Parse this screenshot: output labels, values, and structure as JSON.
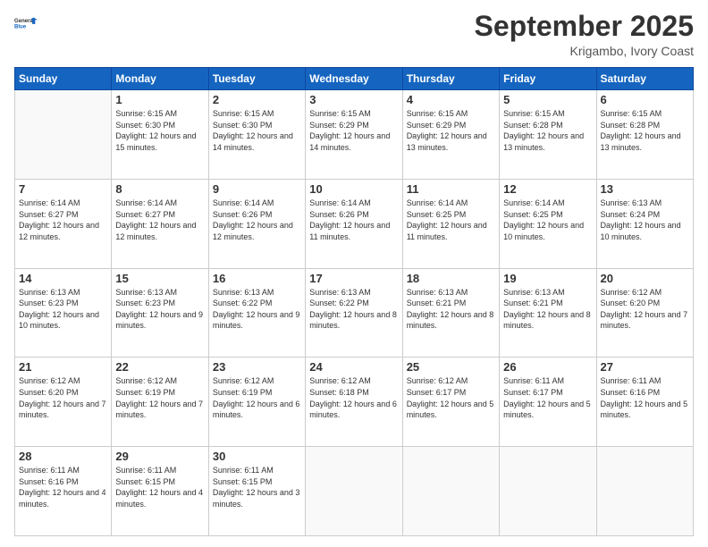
{
  "logo": {
    "line1": "General",
    "line2": "Blue"
  },
  "header": {
    "month": "September 2025",
    "location": "Krigambo, Ivory Coast"
  },
  "weekdays": [
    "Sunday",
    "Monday",
    "Tuesday",
    "Wednesday",
    "Thursday",
    "Friday",
    "Saturday"
  ],
  "weeks": [
    [
      {
        "day": "",
        "sunrise": "",
        "sunset": "",
        "daylight": ""
      },
      {
        "day": "1",
        "sunrise": "Sunrise: 6:15 AM",
        "sunset": "Sunset: 6:30 PM",
        "daylight": "Daylight: 12 hours and 15 minutes."
      },
      {
        "day": "2",
        "sunrise": "Sunrise: 6:15 AM",
        "sunset": "Sunset: 6:30 PM",
        "daylight": "Daylight: 12 hours and 14 minutes."
      },
      {
        "day": "3",
        "sunrise": "Sunrise: 6:15 AM",
        "sunset": "Sunset: 6:29 PM",
        "daylight": "Daylight: 12 hours and 14 minutes."
      },
      {
        "day": "4",
        "sunrise": "Sunrise: 6:15 AM",
        "sunset": "Sunset: 6:29 PM",
        "daylight": "Daylight: 12 hours and 13 minutes."
      },
      {
        "day": "5",
        "sunrise": "Sunrise: 6:15 AM",
        "sunset": "Sunset: 6:28 PM",
        "daylight": "Daylight: 12 hours and 13 minutes."
      },
      {
        "day": "6",
        "sunrise": "Sunrise: 6:15 AM",
        "sunset": "Sunset: 6:28 PM",
        "daylight": "Daylight: 12 hours and 13 minutes."
      }
    ],
    [
      {
        "day": "7",
        "sunrise": "Sunrise: 6:14 AM",
        "sunset": "Sunset: 6:27 PM",
        "daylight": "Daylight: 12 hours and 12 minutes."
      },
      {
        "day": "8",
        "sunrise": "Sunrise: 6:14 AM",
        "sunset": "Sunset: 6:27 PM",
        "daylight": "Daylight: 12 hours and 12 minutes."
      },
      {
        "day": "9",
        "sunrise": "Sunrise: 6:14 AM",
        "sunset": "Sunset: 6:26 PM",
        "daylight": "Daylight: 12 hours and 12 minutes."
      },
      {
        "day": "10",
        "sunrise": "Sunrise: 6:14 AM",
        "sunset": "Sunset: 6:26 PM",
        "daylight": "Daylight: 12 hours and 11 minutes."
      },
      {
        "day": "11",
        "sunrise": "Sunrise: 6:14 AM",
        "sunset": "Sunset: 6:25 PM",
        "daylight": "Daylight: 12 hours and 11 minutes."
      },
      {
        "day": "12",
        "sunrise": "Sunrise: 6:14 AM",
        "sunset": "Sunset: 6:25 PM",
        "daylight": "Daylight: 12 hours and 10 minutes."
      },
      {
        "day": "13",
        "sunrise": "Sunrise: 6:13 AM",
        "sunset": "Sunset: 6:24 PM",
        "daylight": "Daylight: 12 hours and 10 minutes."
      }
    ],
    [
      {
        "day": "14",
        "sunrise": "Sunrise: 6:13 AM",
        "sunset": "Sunset: 6:23 PM",
        "daylight": "Daylight: 12 hours and 10 minutes."
      },
      {
        "day": "15",
        "sunrise": "Sunrise: 6:13 AM",
        "sunset": "Sunset: 6:23 PM",
        "daylight": "Daylight: 12 hours and 9 minutes."
      },
      {
        "day": "16",
        "sunrise": "Sunrise: 6:13 AM",
        "sunset": "Sunset: 6:22 PM",
        "daylight": "Daylight: 12 hours and 9 minutes."
      },
      {
        "day": "17",
        "sunrise": "Sunrise: 6:13 AM",
        "sunset": "Sunset: 6:22 PM",
        "daylight": "Daylight: 12 hours and 8 minutes."
      },
      {
        "day": "18",
        "sunrise": "Sunrise: 6:13 AM",
        "sunset": "Sunset: 6:21 PM",
        "daylight": "Daylight: 12 hours and 8 minutes."
      },
      {
        "day": "19",
        "sunrise": "Sunrise: 6:13 AM",
        "sunset": "Sunset: 6:21 PM",
        "daylight": "Daylight: 12 hours and 8 minutes."
      },
      {
        "day": "20",
        "sunrise": "Sunrise: 6:12 AM",
        "sunset": "Sunset: 6:20 PM",
        "daylight": "Daylight: 12 hours and 7 minutes."
      }
    ],
    [
      {
        "day": "21",
        "sunrise": "Sunrise: 6:12 AM",
        "sunset": "Sunset: 6:20 PM",
        "daylight": "Daylight: 12 hours and 7 minutes."
      },
      {
        "day": "22",
        "sunrise": "Sunrise: 6:12 AM",
        "sunset": "Sunset: 6:19 PM",
        "daylight": "Daylight: 12 hours and 7 minutes."
      },
      {
        "day": "23",
        "sunrise": "Sunrise: 6:12 AM",
        "sunset": "Sunset: 6:19 PM",
        "daylight": "Daylight: 12 hours and 6 minutes."
      },
      {
        "day": "24",
        "sunrise": "Sunrise: 6:12 AM",
        "sunset": "Sunset: 6:18 PM",
        "daylight": "Daylight: 12 hours and 6 minutes."
      },
      {
        "day": "25",
        "sunrise": "Sunrise: 6:12 AM",
        "sunset": "Sunset: 6:17 PM",
        "daylight": "Daylight: 12 hours and 5 minutes."
      },
      {
        "day": "26",
        "sunrise": "Sunrise: 6:11 AM",
        "sunset": "Sunset: 6:17 PM",
        "daylight": "Daylight: 12 hours and 5 minutes."
      },
      {
        "day": "27",
        "sunrise": "Sunrise: 6:11 AM",
        "sunset": "Sunset: 6:16 PM",
        "daylight": "Daylight: 12 hours and 5 minutes."
      }
    ],
    [
      {
        "day": "28",
        "sunrise": "Sunrise: 6:11 AM",
        "sunset": "Sunset: 6:16 PM",
        "daylight": "Daylight: 12 hours and 4 minutes."
      },
      {
        "day": "29",
        "sunrise": "Sunrise: 6:11 AM",
        "sunset": "Sunset: 6:15 PM",
        "daylight": "Daylight: 12 hours and 4 minutes."
      },
      {
        "day": "30",
        "sunrise": "Sunrise: 6:11 AM",
        "sunset": "Sunset: 6:15 PM",
        "daylight": "Daylight: 12 hours and 3 minutes."
      },
      {
        "day": "",
        "sunrise": "",
        "sunset": "",
        "daylight": ""
      },
      {
        "day": "",
        "sunrise": "",
        "sunset": "",
        "daylight": ""
      },
      {
        "day": "",
        "sunrise": "",
        "sunset": "",
        "daylight": ""
      },
      {
        "day": "",
        "sunrise": "",
        "sunset": "",
        "daylight": ""
      }
    ]
  ]
}
